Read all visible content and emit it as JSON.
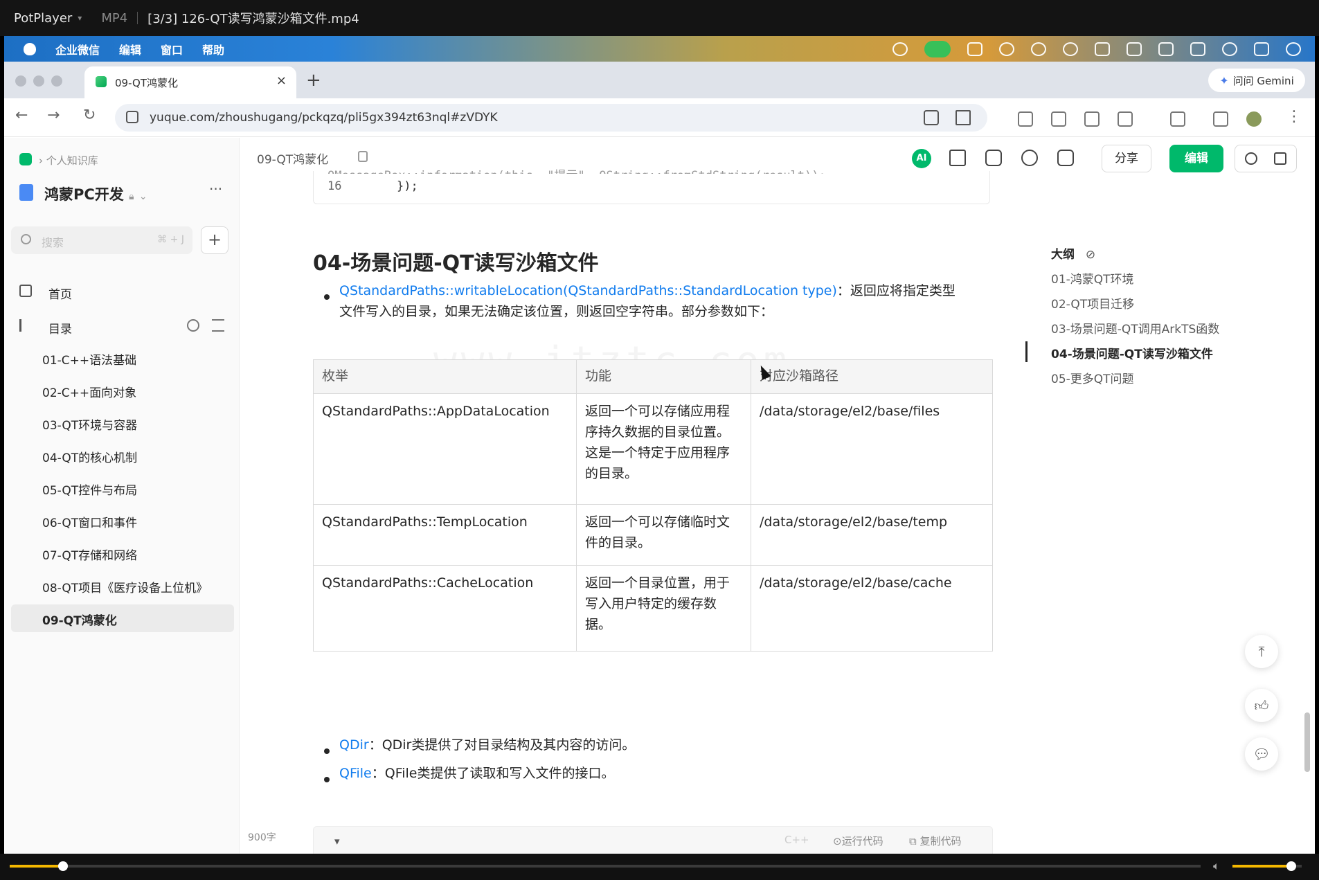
{
  "player": {
    "app_name": "PotPlayer",
    "format": "MP4",
    "file_title": "[3/3] 126-QT读写鸿蒙沙箱文件.mp4",
    "progress": 0.045,
    "volume": 0.85,
    "accent_color": "#f5b800"
  },
  "menubar": {
    "items": [
      "企业微信",
      "编辑",
      "窗口",
      "帮助"
    ]
  },
  "browser": {
    "tab_title": "09-QT鸿蒙化",
    "gemini_label": "问问 Gemini",
    "url": "yuque.com/zhoushugang/pckqzq/pli5gx394zt63nql#zVDYK"
  },
  "sidebar": {
    "breadcrumb": "个人知识库",
    "kb_title": "鸿蒙PC开发",
    "more": "···",
    "search_placeholder": "搜索",
    "search_shortcut": "⌘ + J",
    "add": "+",
    "home": "首页",
    "toc_label": "目录",
    "items": [
      "01-C++语法基础",
      "02-C++面向对象",
      "03-QT环境与容器",
      "04-QT的核心机制",
      "05-QT控件与布局",
      "06-QT窗口和事件",
      "07-QT存储和网络",
      "08-QT项目《医疗设备上位机》",
      "09-QT鸿蒙化"
    ],
    "active_index": 8
  },
  "header": {
    "doc_title": "09-QT鸿蒙化",
    "ai_label": "AI",
    "share_label": "分享",
    "edit_label": "编辑",
    "brand_color": "#00b96b"
  },
  "content": {
    "code_line_number": "16",
    "code_line_text": "});",
    "code_clipped_text": "QMessageBox::information(this, \"提示\", QString::fromStdString(result));",
    "heading": "04-场景问题-QT读写沙箱文件",
    "bullet1_link": "QStandardPaths::writableLocation(QStandardPaths::StandardLocation type)",
    "bullet1_text_a": "：返回应将指定类型",
    "bullet1_text_b": "文件写入的目录，如果无法确定该位置，则返回空字符串。部分参数如下：",
    "table": {
      "headers": [
        "枚举",
        "功能",
        "对应沙箱路径"
      ],
      "rows": [
        [
          "QStandardPaths::AppDataLocation",
          "返回一个可以存储应用程序持久数据的目录位置。这是一个特定于应用程序的目录。",
          "/data/storage/el2/base/files"
        ],
        [
          "QStandardPaths::TempLocation",
          "返回一个可以存储临时文件的目录。",
          "/data/storage/el2/base/temp"
        ],
        [
          "QStandardPaths::CacheLocation",
          "返回一个目录位置，用于写入用户特定的缓存数据。",
          "/data/storage/el2/base/cache"
        ]
      ]
    },
    "bullet2_link": "QDir",
    "bullet2_text": "：QDir类提供了对目录结构及其内容的访问。",
    "bullet3_link": "QFile",
    "bullet3_text": "：QFile类提供了读取和写入文件的接口。",
    "word_count": "900字",
    "bottom_code_lang": "C++",
    "run_code": "运行代码",
    "copy_code": "复制代码",
    "watermark": "www.itztc.com"
  },
  "outline": {
    "title": "大纲",
    "items": [
      "01-鸿蒙QT环境",
      "02-QT项目迁移",
      "03-场景问题-QT调用ArkTS函数",
      "04-场景问题-QT读写沙箱文件",
      "05-更多QT问题"
    ],
    "active_index": 3
  }
}
